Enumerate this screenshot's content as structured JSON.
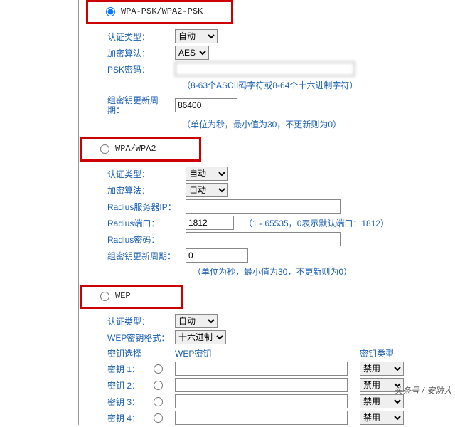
{
  "sections": {
    "psk": {
      "radio_label": "WPA-PSK/WPA2-PSK",
      "auth_label": "认证类型：",
      "auth_value": "自动",
      "enc_label": "加密算法：",
      "enc_value": "AES",
      "psk_label": "PSK密码：",
      "psk_value": "",
      "psk_hint": "（8-63个ASCII码字符或8-64个十六进制字符）",
      "gkey_label": "组密钥更新周期：",
      "gkey_value": "86400",
      "gkey_hint": "（单位为秒，最小值为30，不更新则为0）"
    },
    "wpa": {
      "radio_label": "WPA/WPA2",
      "auth_label": "认证类型：",
      "auth_value": "自动",
      "enc_label": "加密算法：",
      "enc_value": "自动",
      "srvip_label": "Radius服务器IP：",
      "srvip_value": "",
      "port_label": "Radius端口：",
      "port_value": "1812",
      "port_hint": "（1 - 65535，0表示默认端口：1812）",
      "pwd_label": "Radius密码：",
      "pwd_value": "",
      "gkey_label": "组密钥更新周期：",
      "gkey_value": "0",
      "gkey_hint": "（单位为秒，最小值为30，不更新则为0）"
    },
    "wep": {
      "radio_label": "WEP",
      "auth_label": "认证类型：",
      "auth_value": "自动",
      "fmt_label": "WEP密钥格式：",
      "fmt_value": "十六进制",
      "hdr_select": "密钥选择",
      "hdr_key": "WEP密钥",
      "hdr_type": "密钥类型",
      "keys": [
        {
          "label": "密钥 1：",
          "type": "禁用"
        },
        {
          "label": "密钥 2：",
          "type": "禁用"
        },
        {
          "label": "密钥 3：",
          "type": "禁用"
        },
        {
          "label": "密钥 4：",
          "type": "禁用"
        }
      ]
    }
  },
  "watermark": "头条号 / 安防人"
}
